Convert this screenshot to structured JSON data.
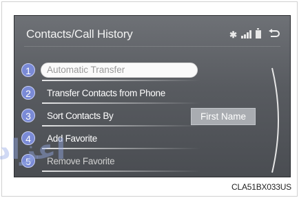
{
  "header": {
    "title": "Contacts/Call History",
    "status_icons": [
      "bluetooth-icon",
      "signal-icon",
      "battery-icon"
    ],
    "back_icon": "back-arrow-icon"
  },
  "menu": {
    "items": [
      {
        "number": "1",
        "label": "Automatic Transfer",
        "highlighted": true
      },
      {
        "number": "2",
        "label": "Transfer Contacts from Phone"
      },
      {
        "number": "3",
        "label": "Sort Contacts By",
        "value": "First Name"
      },
      {
        "number": "4",
        "label": "Add Favorite"
      },
      {
        "number": "5",
        "label": "Remove Favorite"
      }
    ]
  },
  "watermark": "اعزاد",
  "figure_code": "CLA51BX033US",
  "colors": {
    "screen_bg": "#5e6166",
    "badge": "#7a8ad6",
    "value_box": "#a9acb1"
  }
}
